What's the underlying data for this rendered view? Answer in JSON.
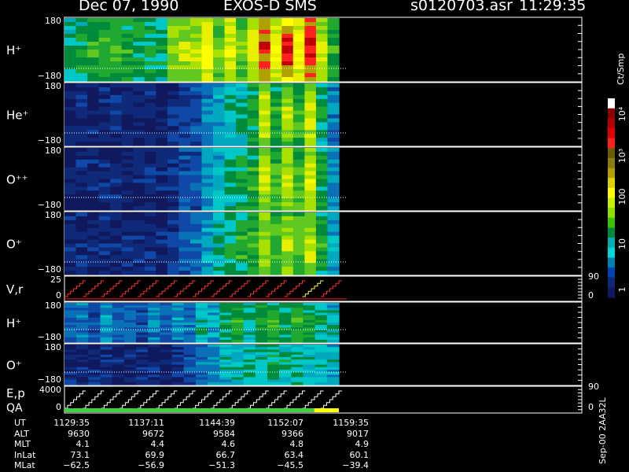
{
  "header": {
    "date": "Dec 07, 1990",
    "mission": "EXOS-D SMS",
    "file": "s0120703.asr",
    "time": "11:29:35"
  },
  "footer_vertical": "Sep-00  2AA32L",
  "colorbar": {
    "unit": "Ct/Smp",
    "tick_labels": [
      "10⁴",
      "10³",
      "100",
      "10",
      "1"
    ],
    "colors": [
      "#ffffff",
      "#8b0000",
      "#b40000",
      "#e00000",
      "#ff2020",
      "#6b5e00",
      "#8b7d10",
      "#b0a000",
      "#e0d000",
      "#ffff00",
      "#c8f000",
      "#8ce000",
      "#40c000",
      "#008a3c",
      "#00b0b0",
      "#00d8d8",
      "#0080b0",
      "#0040b0",
      "#102878",
      "#101860"
    ]
  },
  "time_axis": {
    "labels": [
      "UT",
      "ALT",
      "MLT",
      "InLat",
      "MLat"
    ],
    "columns": [
      [
        "1129:35",
        "9630",
        "4.1",
        "73.1",
        "−62.5"
      ],
      [
        "1137:11",
        "9672",
        "4.4",
        "69.9",
        "−56.9"
      ],
      [
        "1144:39",
        "9584",
        "4.6",
        "66.7",
        "−51.3"
      ],
      [
        "1152:07",
        "9366",
        "4.8",
        "63.4",
        "−45.5"
      ],
      [
        "1159:35",
        "9017",
        "4.9",
        "60.1",
        "−39.4"
      ]
    ]
  },
  "chart_data": [
    {
      "type": "heatmap",
      "panel": "H⁺",
      "y_ticks": [
        "180",
        "−180"
      ],
      "ylim": [
        -180,
        180
      ],
      "intensity_profile": [
        1.3,
        1.4,
        1.6,
        1.7,
        1.7,
        1.6,
        1.5,
        1.5,
        1.4,
        2.0,
        2.1,
        2.2,
        2.6,
        2.0,
        2.4,
        2.0,
        2.3,
        3.2,
        2.5,
        3.3,
        2.6,
        3.4,
        2.2,
        1.6
      ]
    },
    {
      "type": "heatmap",
      "panel": "He⁺",
      "y_ticks": [
        "180",
        "−180"
      ],
      "ylim": [
        -180,
        180
      ],
      "intensity_profile": [
        0.2,
        0.2,
        0.2,
        0.2,
        0.2,
        0.2,
        0.2,
        0.2,
        0.2,
        0.3,
        0.4,
        0.5,
        0.8,
        1.0,
        1.2,
        1.3,
        1.5,
        2.2,
        1.6,
        2.1,
        1.7,
        2.2,
        1.4,
        0.8
      ]
    },
    {
      "type": "heatmap",
      "panel": "O⁺⁺",
      "y_ticks": [
        "180",
        "−180"
      ],
      "ylim": [
        -180,
        180
      ],
      "intensity_profile": [
        0.2,
        0.2,
        0.2,
        0.2,
        0.2,
        0.2,
        0.2,
        0.2,
        0.2,
        0.3,
        0.5,
        0.6,
        0.9,
        1.1,
        1.3,
        1.5,
        1.6,
        2.2,
        1.7,
        2.2,
        1.8,
        2.3,
        1.5,
        0.9
      ]
    },
    {
      "type": "heatmap",
      "panel": "O⁺",
      "y_ticks": [
        "180",
        "−180"
      ],
      "ylim": [
        -180,
        180
      ],
      "intensity_profile": [
        0.2,
        0.2,
        0.2,
        0.2,
        0.2,
        0.2,
        0.2,
        0.2,
        0.2,
        0.4,
        0.6,
        0.7,
        1.0,
        1.2,
        1.4,
        1.6,
        1.7,
        2.2,
        1.8,
        2.2,
        1.8,
        2.2,
        1.6,
        1.0
      ]
    },
    {
      "type": "line",
      "panel": "V,r",
      "y_ticks": [
        "25",
        "0"
      ],
      "right_ticks": [
        "90",
        "0"
      ],
      "ylim": [
        0,
        25
      ],
      "sweep_count": 15
    },
    {
      "type": "heatmap",
      "panel": "H⁺",
      "y_ticks": [
        "180",
        "−180"
      ],
      "ylim": [
        -180,
        180
      ],
      "intensity_profile": [
        0.6,
        0.8,
        0.5,
        0.9,
        0.6,
        0.7,
        0.5,
        0.8,
        0.6,
        0.9,
        0.7,
        1.2,
        1.0,
        1.4,
        1.6,
        1.3,
        1.5,
        1.7,
        1.4,
        1.6,
        1.5,
        1.3,
        1.2
      ]
    },
    {
      "type": "heatmap",
      "panel": "O⁺",
      "y_ticks": [
        "180",
        "−180"
      ],
      "ylim": [
        -180,
        180
      ],
      "intensity_profile": [
        0.2,
        0.2,
        0.2,
        0.2,
        0.2,
        0.2,
        0.2,
        0.2,
        0.2,
        0.3,
        0.5,
        0.7,
        0.9,
        1.1,
        1.2,
        1.3,
        1.3,
        1.4,
        1.3,
        1.3,
        1.2,
        1.2,
        1.1
      ]
    },
    {
      "type": "line",
      "panel": "E,p",
      "panel2": "QA",
      "y_ticks": [
        "4000",
        "0"
      ],
      "right_ticks": [
        "90",
        "0"
      ],
      "ylim": [
        0,
        4000
      ],
      "sweep_count": 15
    }
  ]
}
